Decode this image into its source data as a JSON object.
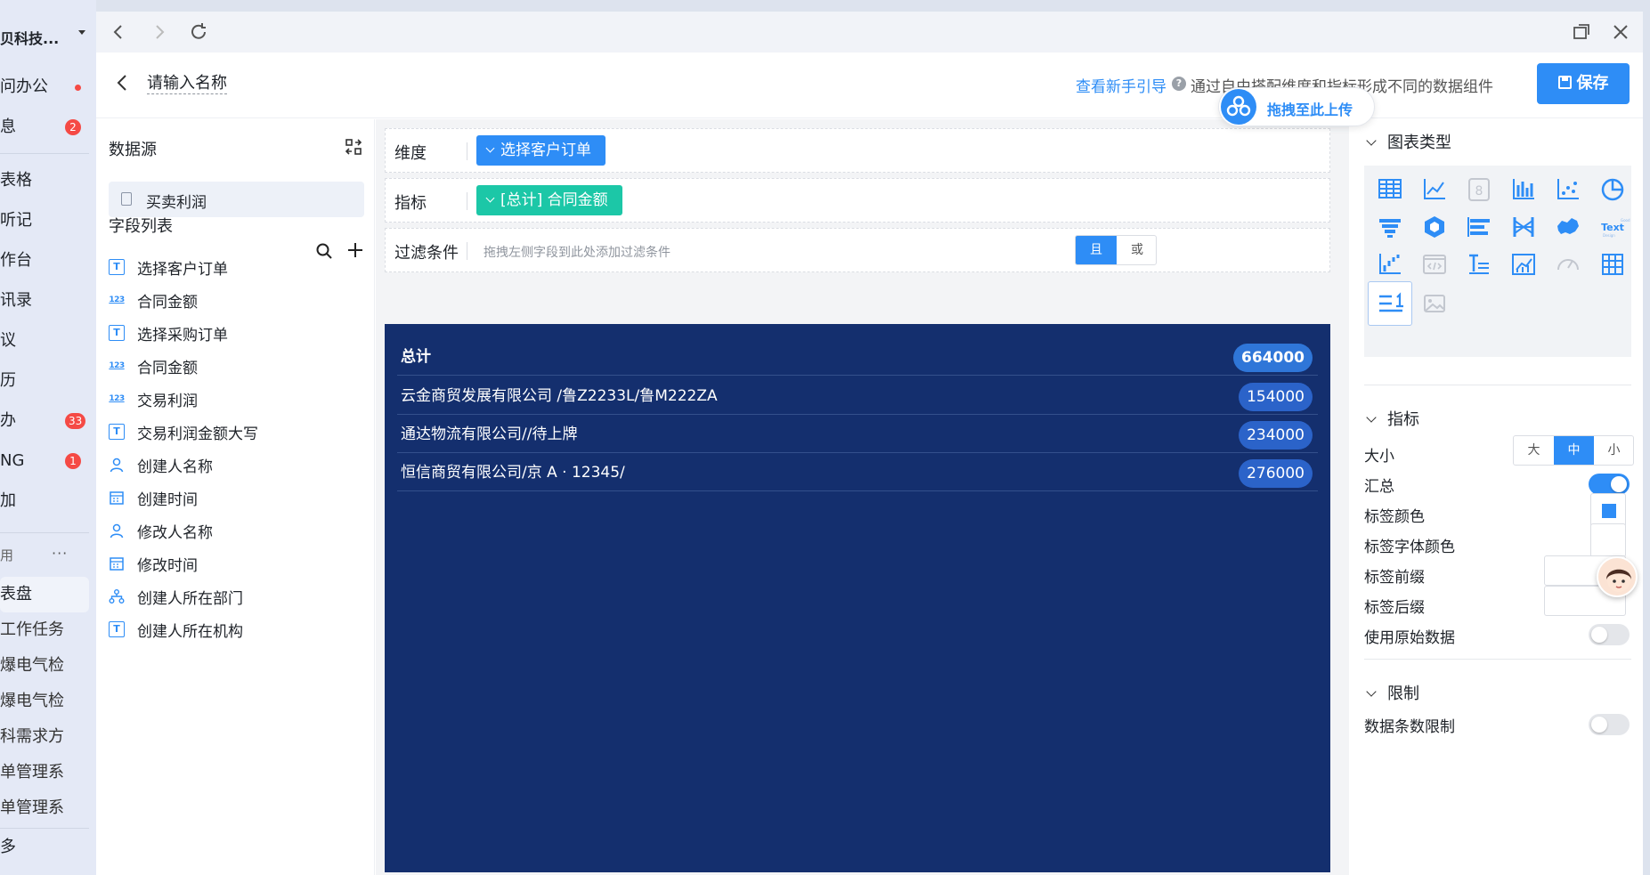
{
  "app_sidebar": {
    "org_name": "贝科技...",
    "items": [
      {
        "label": "问办公",
        "dot": true
      },
      {
        "label": "息",
        "badge": "2"
      },
      {
        "label": "表格"
      },
      {
        "label": "听记"
      },
      {
        "label": "作台"
      },
      {
        "label": "讯录"
      },
      {
        "label": "议"
      },
      {
        "label": "历"
      },
      {
        "label": "办",
        "badge": "33"
      },
      {
        "label": "NG",
        "badge": "1"
      },
      {
        "label": "加"
      }
    ],
    "section_label": "用",
    "section_more": "···",
    "apps": [
      "表盘",
      "工作任务",
      "爆电气检",
      "爆电气检",
      "科需求方",
      "单管理系",
      "单管理系"
    ],
    "more_label": "多"
  },
  "header": {
    "name_placeholder": "请输入名称",
    "guide_link": "查看新手引导",
    "hint": "通过自由搭配维度和指标形成不同的数据组件",
    "save_label": "保存"
  },
  "upload_widget": {
    "label": "拖拽至此上传"
  },
  "fields_panel": {
    "datasource_title": "数据源",
    "datasource_item": "买卖利润",
    "field_list_title": "字段列表",
    "fields": [
      {
        "type": "text",
        "icon_text": "T",
        "label": "选择客户订单"
      },
      {
        "type": "number",
        "icon_text": "123",
        "label": "合同金额"
      },
      {
        "type": "text",
        "icon_text": "T",
        "label": "选择采购订单"
      },
      {
        "type": "number",
        "icon_text": "123",
        "label": "合同金额"
      },
      {
        "type": "number",
        "icon_text": "123",
        "label": "交易利润"
      },
      {
        "type": "text",
        "icon_text": "T",
        "label": "交易利润金额大写"
      },
      {
        "type": "user",
        "icon_text": "",
        "label": "创建人名称"
      },
      {
        "type": "date",
        "icon_text": "",
        "label": "创建时间"
      },
      {
        "type": "user",
        "icon_text": "",
        "label": "修改人名称"
      },
      {
        "type": "date",
        "icon_text": "",
        "label": "修改时间"
      },
      {
        "type": "dept",
        "icon_text": "",
        "label": "创建人所在部门"
      },
      {
        "type": "text",
        "icon_text": "T",
        "label": "创建人所在机构"
      }
    ]
  },
  "config": {
    "dimension_label": "维度",
    "dimension_value": "选择客户订单",
    "metric_label": "指标",
    "metric_value": "[总计] 合同金额",
    "filter_label": "过滤条件",
    "filter_hint": "拖拽左侧字段到此处添加过滤条件",
    "filter_and": "且",
    "filter_or": "或"
  },
  "preview": {
    "total_label": "总计",
    "total_value": "664000",
    "rows": [
      {
        "label": "云金商贸发展有限公司 /鲁Z2233L/鲁M222ZA",
        "value": "154000"
      },
      {
        "label": "通达物流有限公司//待上牌",
        "value": "234000"
      },
      {
        "label": "恒信商贸有限公司/京 A · 12345/",
        "value": "276000"
      }
    ]
  },
  "settings": {
    "chart_type_title": "图表类型",
    "chart_types": [
      "table-icon",
      "line-chart-icon",
      "number-card-icon",
      "bar-chart-icon",
      "scatter-icon",
      "pie-chart-icon",
      "funnel-icon",
      "3d-icon",
      "bar-horizontal-icon",
      "sankey-icon",
      "china-map-icon",
      "word-cloud-icon",
      "waterfall-icon",
      "code-icon",
      "text-list-icon",
      "combo-chart-icon",
      "gauge-icon",
      "pivot-table-icon",
      "metric-list-icon",
      "image-icon"
    ],
    "word_cloud_text": "Text",
    "metric_title": "指标",
    "size_label": "大小",
    "size_options": [
      "大",
      "中",
      "小"
    ],
    "size_selected": "中",
    "summary_label": "汇总",
    "summary_on": true,
    "label_color_label": "标签颜色",
    "label_color": "#2e8df6",
    "label_font_color_label": "标签字体颜色",
    "label_prefix_label": "标签前缀",
    "label_suffix_label": "标签后缀",
    "raw_data_label": "使用原始数据",
    "limit_title": "限制",
    "row_limit_label": "数据条数限制"
  },
  "colors": {
    "accent": "#2e8df6",
    "metric_pill": "#1cc7a7",
    "preview_bg": "#142f6e"
  }
}
